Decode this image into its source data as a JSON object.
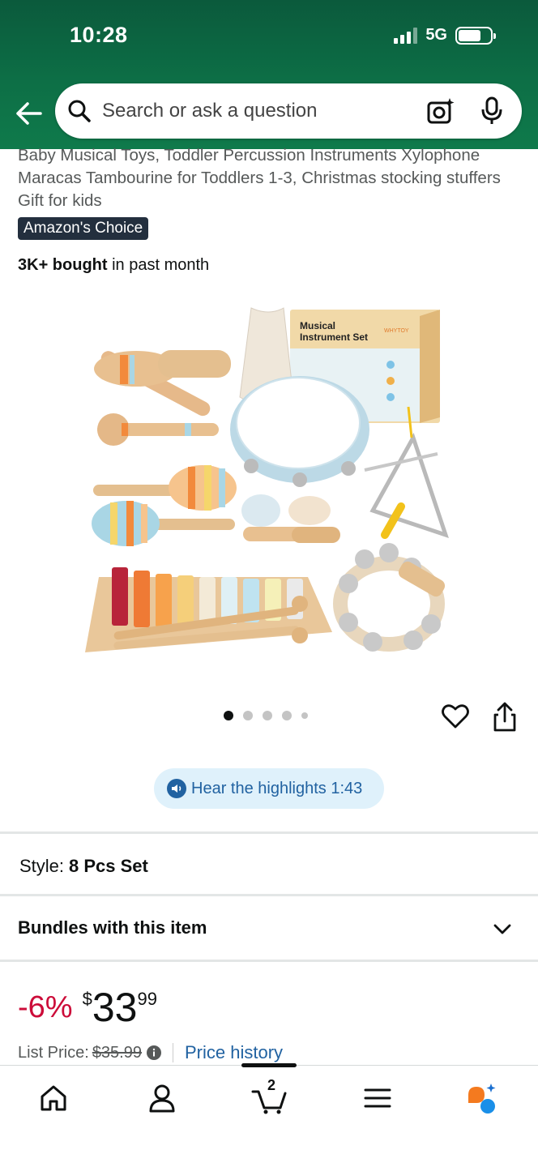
{
  "status": {
    "time": "10:28",
    "network": "5G"
  },
  "search": {
    "placeholder": "Search or ask a question"
  },
  "product": {
    "title": "Baby Musical Toys, Toddler Percussion Instruments Xylophone Maracas Tambourine for Toddlers 1-3, Christmas stocking stuffers Gift for kids",
    "badge": "Amazon's Choice",
    "bought_bold": "3K+ bought",
    "bought_rest": " in past month",
    "box_text": "Musical Instrument Set",
    "brand_on_box": "WHYTOY",
    "image_count": 5,
    "active_image": 1
  },
  "highlights": {
    "label": "Hear the highlights 1:43"
  },
  "style": {
    "label": "Style:",
    "value": "8 Pcs Set"
  },
  "bundles": {
    "label": "Bundles with this item"
  },
  "price": {
    "discount": "-6%",
    "currency": "$",
    "whole": "33",
    "fraction": "99",
    "list_label": "List Price:",
    "list_value": "$35.99",
    "history_link": "Price history"
  },
  "nav": {
    "cart_count": "2"
  },
  "colors": {
    "header": "#0d6f46",
    "accent_link": "#2162a1",
    "discount": "#cc0c39",
    "badge_bg": "#232f3e",
    "rufus": "#f47a1f"
  }
}
